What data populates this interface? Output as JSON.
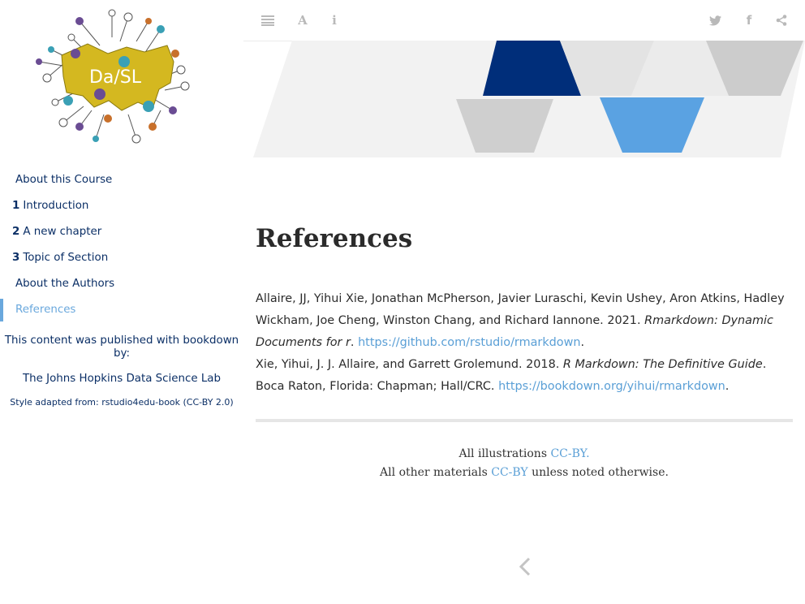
{
  "sidebar": {
    "logo_text": "Da/SL",
    "items": [
      {
        "num": "",
        "label": "About this Course"
      },
      {
        "num": "1",
        "label": "Introduction"
      },
      {
        "num": "2",
        "label": "A new chapter"
      },
      {
        "num": "3",
        "label": "Topic of Section"
      },
      {
        "num": "",
        "label": "About the Authors"
      },
      {
        "num": "",
        "label": "References"
      }
    ],
    "published_with": "This content was published with bookdown by:",
    "lab": "The Johns Hopkins Data Science Lab",
    "style_adapted": "Style adapted from: rstudio4edu-book (CC-BY 2.0)"
  },
  "toolbar": {
    "left_icons": [
      "list-icon",
      "font-icon",
      "info-icon"
    ],
    "right_icons": [
      "twitter-icon",
      "facebook-icon",
      "share-icon"
    ],
    "font_glyph": "A",
    "info_glyph": "i",
    "facebook_glyph": "f"
  },
  "page": {
    "title": "References",
    "ref1": {
      "authors": "Allaire, JJ, Yihui Xie, Jonathan McPherson, Javier Luraschi, Kevin Ushey, Aron Atkins, Hadley Wickham, Joe Cheng, Winston Chang, and Richard Iannone. 2021. ",
      "title": "Rmarkdown: Dynamic Documents for r",
      "after": ". ",
      "url": "https://github.com/rstudio/rmarkdown",
      "end": "."
    },
    "ref2": {
      "authors": "Xie, Yihui, J. J. Allaire, and Garrett Grolemund. 2018. ",
      "title": "R Markdown: The Definitive Guide",
      "after": ". Boca Raton, Florida: Chapman; Hall/CRC. ",
      "url": "https://bookdown.org/yihui/rmarkdown",
      "end": "."
    }
  },
  "footer": {
    "line1_prefix": "All illustrations ",
    "line1_link": "CC-BY.",
    "line2_prefix": "All other materials ",
    "line2_link": "CC-BY",
    "line2_suffix": " unless noted otherwise."
  },
  "colors": {
    "nav_text": "#0b2f66",
    "active": "#6aa8dd",
    "link": "#5a9fd6",
    "banner_dark": "#002e7a",
    "banner_light_blue": "#5aa2e2",
    "logo_yellow": "#d4b820"
  }
}
